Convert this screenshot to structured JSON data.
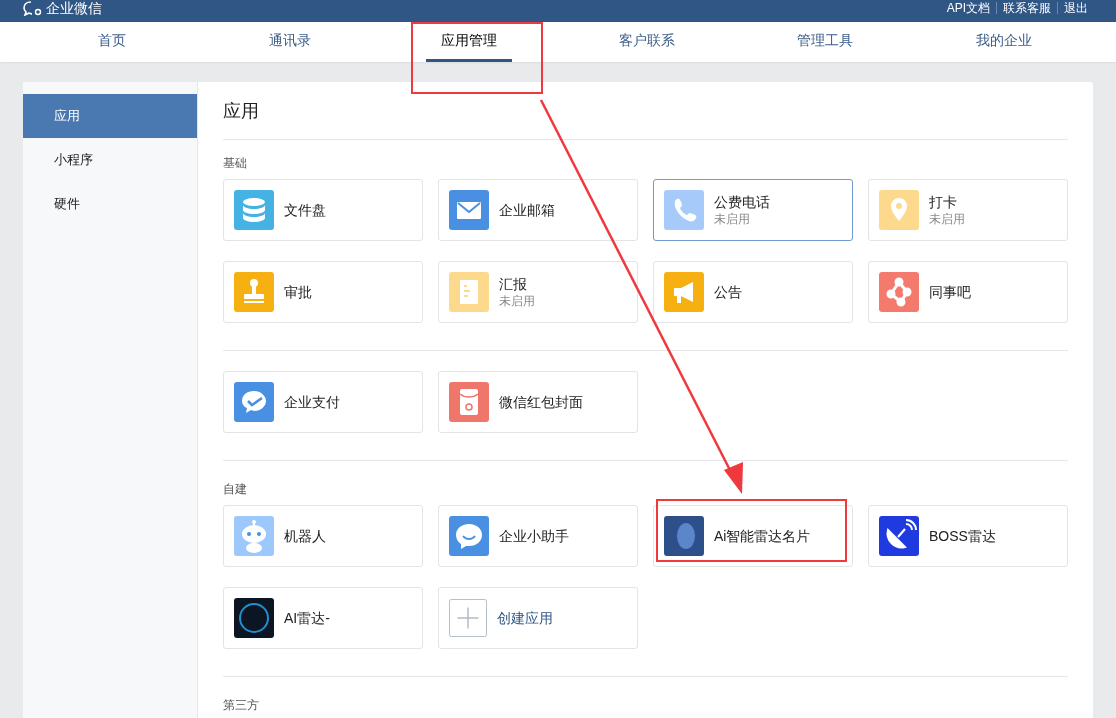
{
  "top_bar": {
    "logo": "企业微信",
    "links": [
      "API文档",
      "联系客服",
      "退出"
    ]
  },
  "nav_tabs": [
    {
      "label": "首页",
      "selected": false
    },
    {
      "label": "通讯录",
      "selected": false
    },
    {
      "label": "应用管理",
      "selected": true
    },
    {
      "label": "客户联系",
      "selected": false
    },
    {
      "label": "管理工具",
      "selected": false
    },
    {
      "label": "我的企业",
      "selected": false
    }
  ],
  "sidebar": {
    "items": [
      {
        "label": "应用",
        "selected": true
      },
      {
        "label": "小程序",
        "selected": false
      },
      {
        "label": "硬件",
        "selected": false
      }
    ]
  },
  "content": {
    "title": "应用",
    "sections": [
      {
        "title": "基础",
        "apps": [
          {
            "kind": "app",
            "name": "文件盘",
            "color": "#44b2e2",
            "selected": false
          },
          {
            "kind": "app",
            "name": "企业邮箱",
            "color": "#4a90e2",
            "selected": false
          },
          {
            "kind": "app",
            "name": "公费电话",
            "status": "未启用",
            "color": "#a6cbfa",
            "selected": true
          },
          {
            "kind": "app",
            "name": "打卡",
            "status": "未启用",
            "color": "#fcd98c",
            "selected": false
          },
          {
            "kind": "app",
            "name": "审批",
            "color": "#f6b012",
            "selected": false
          },
          {
            "kind": "app",
            "name": "汇报",
            "status": "未启用",
            "color": "#fcd98c",
            "selected": false
          },
          {
            "kind": "app",
            "name": "公告",
            "color": "#f6b012",
            "selected": false
          },
          {
            "kind": "app",
            "name": "同事吧",
            "color": "#f57a6e",
            "selected": false
          }
        ]
      },
      {
        "apps": [
          {
            "kind": "app",
            "name": "企业支付",
            "color": "#4a90e2",
            "selected": false
          },
          {
            "kind": "app",
            "name": "微信红包封面",
            "color": "#ef766b",
            "selected": false
          }
        ]
      },
      {
        "title": "自建",
        "apps": [
          {
            "kind": "app",
            "name": "机器人",
            "color": "#9cc8fb",
            "selected": false
          },
          {
            "kind": "app",
            "name": "企业小助手",
            "color": "#4a90e2",
            "selected": false
          },
          {
            "kind": "app",
            "name": "Ai智能雷达名片",
            "color": "#2d4f8a",
            "selected": false
          },
          {
            "kind": "app",
            "name": "BOSS雷达",
            "color": "#1f3be0",
            "selected": false
          },
          {
            "kind": "app",
            "name": "AI雷达-",
            "color": "#0c1622",
            "selected": false
          },
          {
            "kind": "create",
            "name": "创建应用"
          }
        ]
      },
      {
        "title": "第三方"
      }
    ]
  }
}
